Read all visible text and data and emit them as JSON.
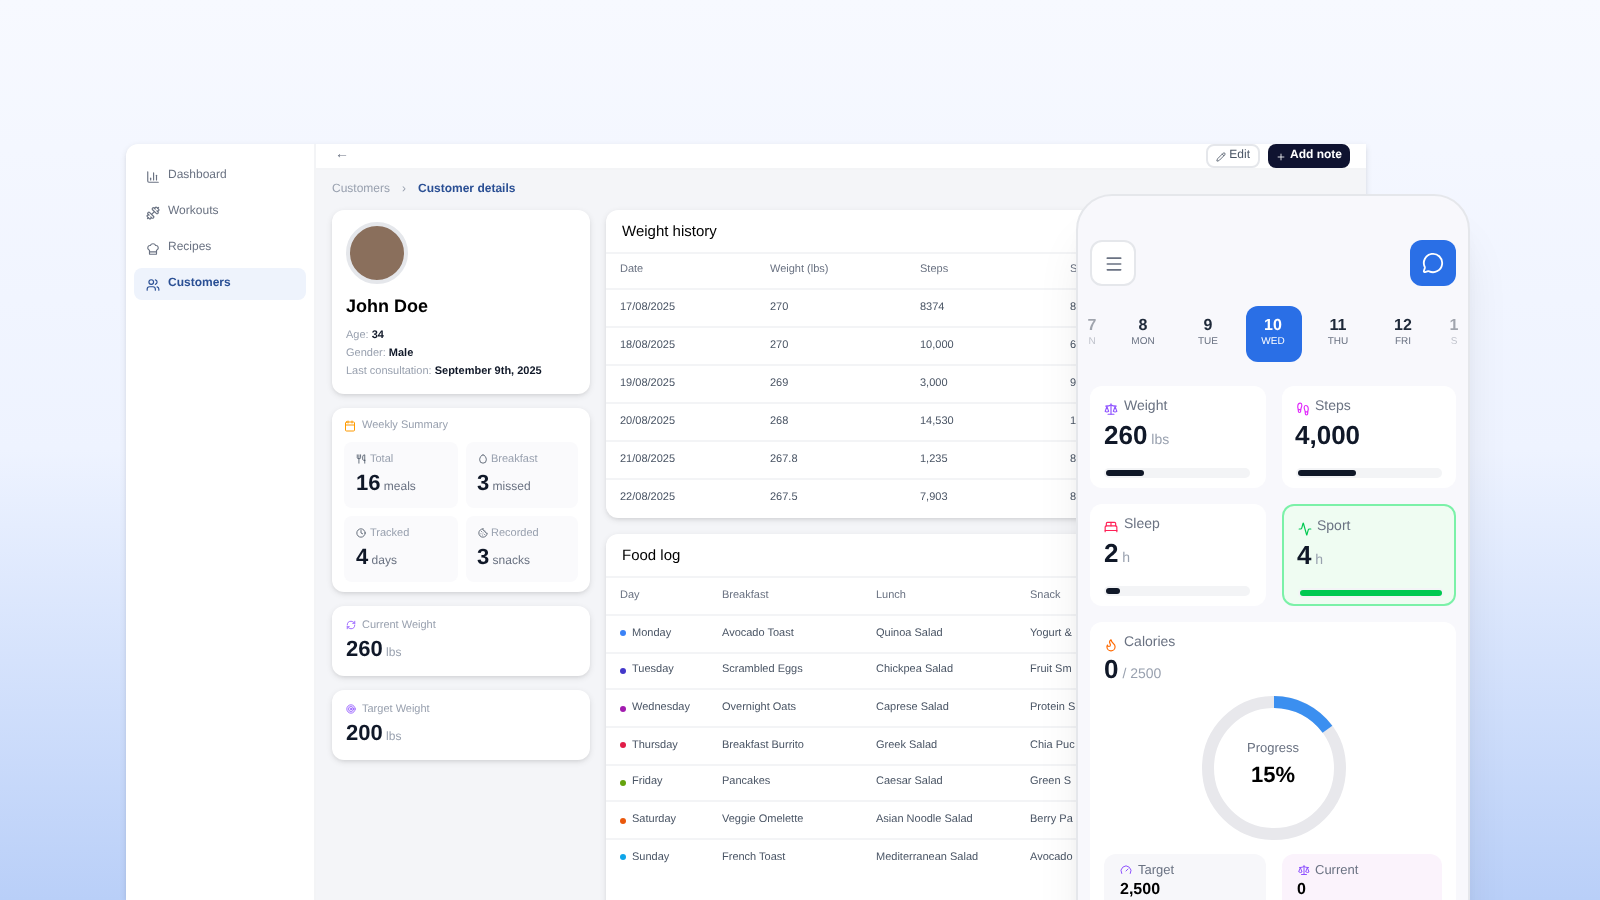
{
  "sidebar": {
    "items": [
      {
        "label": "Dashboard",
        "selected": false
      },
      {
        "label": "Workouts",
        "selected": false
      },
      {
        "label": "Recipes",
        "selected": false
      },
      {
        "label": "Customers",
        "selected": true
      }
    ]
  },
  "toolbar": {
    "back": "←",
    "edit": "Edit",
    "add_note": "Add note"
  },
  "breadcrumb": [
    {
      "label": "Customers",
      "selected": false
    },
    {
      "label": "Customer details",
      "selected": true
    }
  ],
  "breadcrumb_separator": "›",
  "profile": {
    "name": "John Doe",
    "fields": [
      {
        "label": "Age:",
        "value": "34"
      },
      {
        "label": "Gender:",
        "value": "Male"
      },
      {
        "label": "Last consultation:",
        "value": "September 9th, 2025"
      }
    ]
  },
  "weekly_summary": {
    "title": "Weekly Summary",
    "stats": [
      {
        "label": "Total",
        "value": "16",
        "unit": "meals"
      },
      {
        "label": "Breakfast",
        "value": "3",
        "unit": "missed"
      },
      {
        "label": "Tracked",
        "value": "4",
        "unit": "days"
      },
      {
        "label": "Recorded",
        "value": "3",
        "unit": "snacks"
      }
    ]
  },
  "weights": [
    {
      "label": "Current Weight",
      "value": "260",
      "unit": "lbs"
    },
    {
      "label": "Target Weight",
      "value": "200",
      "unit": "lbs"
    }
  ],
  "weight_history": {
    "title": "Weight history",
    "columns": [
      "Date",
      "Weight (lbs)",
      "Steps",
      "S"
    ],
    "rows": [
      [
        "17/08/2025",
        "270",
        "8374",
        "8"
      ],
      [
        "18/08/2025",
        "270",
        "10,000",
        "6"
      ],
      [
        "19/08/2025",
        "269",
        "3,000",
        "9"
      ],
      [
        "20/08/2025",
        "268",
        "14,530",
        "1"
      ],
      [
        "21/08/2025",
        "267.8",
        "1,235",
        "8"
      ],
      [
        "22/08/2025",
        "267.5",
        "7,903",
        "8"
      ]
    ]
  },
  "food_log": {
    "title": "Food log",
    "columns": [
      "Day",
      "Breakfast",
      "Lunch",
      "Snack"
    ],
    "rows": [
      {
        "color": "#3b82f6",
        "cells": [
          "Monday",
          "Avocado Toast",
          "Quinoa Salad",
          "Yogurt &"
        ]
      },
      {
        "color": "#4338ca",
        "cells": [
          "Tuesday",
          "Scrambled Eggs",
          "Chickpea Salad",
          "Fruit Sm"
        ]
      },
      {
        "color": "#a21caf",
        "cells": [
          "Wednesday",
          "Overnight Oats",
          "Caprese Salad",
          "Protein S"
        ]
      },
      {
        "color": "#e11d48",
        "cells": [
          "Thursday",
          "Breakfast Burrito",
          "Greek Salad",
          "Chia Puc"
        ]
      },
      {
        "color": "#65a30d",
        "cells": [
          "Friday",
          "Pancakes",
          "Caesar Salad",
          "Green S"
        ]
      },
      {
        "color": "#ea580c",
        "cells": [
          "Saturday",
          "Veggie Omelette",
          "Asian Noodle Salad",
          "Berry Pa"
        ]
      },
      {
        "color": "#0ea5e9",
        "cells": [
          "Sunday",
          "French Toast",
          "Mediterranean Salad",
          "Avocado"
        ]
      }
    ]
  },
  "phone": {
    "days": [
      {
        "date": "7",
        "weekday": "N",
        "selected": false
      },
      {
        "date": "8",
        "weekday": "MON",
        "selected": false
      },
      {
        "date": "9",
        "weekday": "TUE",
        "selected": false
      },
      {
        "date": "10",
        "weekday": "WED",
        "selected": true
      },
      {
        "date": "11",
        "weekday": "THU",
        "selected": false
      },
      {
        "date": "12",
        "weekday": "FRI",
        "selected": false
      },
      {
        "date": "1",
        "weekday": "S",
        "selected": false
      }
    ],
    "metrics": [
      {
        "label": "Weight",
        "value": "260",
        "unit": "lbs",
        "level": 0.27,
        "selected": false
      },
      {
        "label": "Steps",
        "value": "4,000",
        "level": 0.41,
        "selected": false
      },
      {
        "label": "Sleep",
        "value": "2",
        "unit": "h",
        "level": 0.1,
        "selected": false
      },
      {
        "label": "Sport",
        "value": "4",
        "unit": "h",
        "level": 1,
        "selected": true
      }
    ],
    "calories": {
      "label": "Calories",
      "value": "0",
      "total": "/ 2500",
      "progress_label": "Progress",
      "progress_text": "15%",
      "level": 0.15
    },
    "bottom": [
      {
        "label": "Target",
        "value": "2,500"
      },
      {
        "label": "Current",
        "value": "0"
      }
    ]
  }
}
